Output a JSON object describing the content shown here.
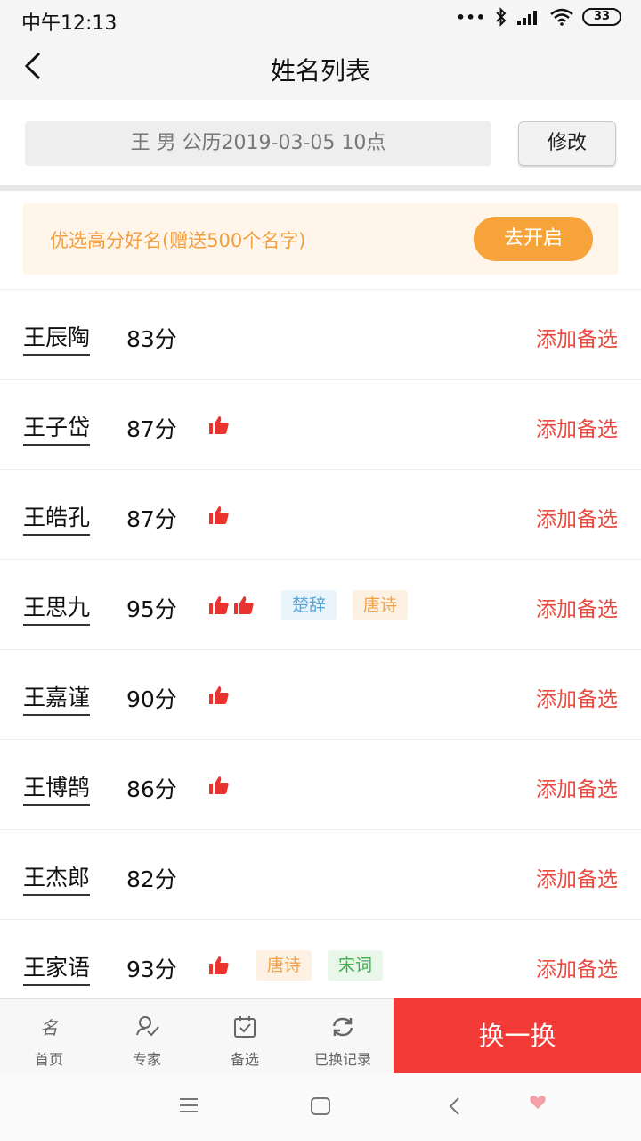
{
  "status": {
    "time": "中午12:13",
    "battery": "33"
  },
  "header": {
    "title": "姓名列表"
  },
  "info": {
    "summary": "王 男 公历2019-03-05 10点",
    "edit_label": "修改"
  },
  "promo": {
    "text": "优选高分好名(赠送500个名字)",
    "button": "去开启"
  },
  "list": {
    "items": [
      {
        "name": "王辰陶",
        "score": "83分",
        "thumbs": 0,
        "tags": [],
        "action": "添加备选"
      },
      {
        "name": "王子岱",
        "score": "87分",
        "thumbs": 1,
        "tags": [],
        "action": "添加备选"
      },
      {
        "name": "王皓孔",
        "score": "87分",
        "thumbs": 1,
        "tags": [],
        "action": "添加备选"
      },
      {
        "name": "王思九",
        "score": "95分",
        "thumbs": 2,
        "tags": [
          "楚辞",
          "唐诗"
        ],
        "action": "添加备选"
      },
      {
        "name": "王嘉谨",
        "score": "90分",
        "thumbs": 1,
        "tags": [],
        "action": "添加备选"
      },
      {
        "name": "王博鹄",
        "score": "86分",
        "thumbs": 1,
        "tags": [],
        "action": "添加备选"
      },
      {
        "name": "王杰郎",
        "score": "82分",
        "thumbs": 0,
        "tags": [],
        "action": "添加备选"
      },
      {
        "name": "王家语",
        "score": "93分",
        "thumbs": 1,
        "tags": [
          "唐诗",
          "宋词"
        ],
        "action": "添加备选"
      }
    ]
  },
  "tabbar": {
    "tabs": [
      {
        "label": "首页",
        "icon": "name-char-icon"
      },
      {
        "label": "专家",
        "icon": "expert-icon"
      },
      {
        "label": "备选",
        "icon": "calendar-check-icon"
      },
      {
        "label": "已换记录",
        "icon": "refresh-icon"
      }
    ],
    "swap_label": "换一换"
  },
  "colors": {
    "accent_red": "#f23b36",
    "action_red": "#e94a3f",
    "promo_orange": "#f6a43a"
  }
}
